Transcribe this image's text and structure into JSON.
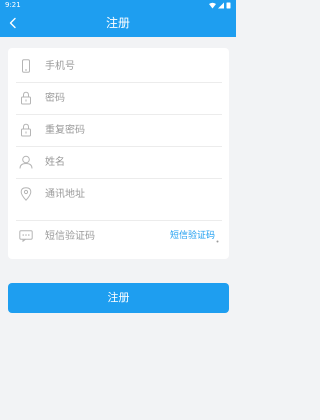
{
  "status_bar": {
    "time": "9:21"
  },
  "nav": {
    "title": "注册"
  },
  "form": {
    "phone_placeholder": "手机号",
    "password_placeholder": "密码",
    "confirm_password_placeholder": "重复密码",
    "name_placeholder": "姓名",
    "address_placeholder": "通讯地址",
    "sms_code_placeholder": "短信验证码",
    "sms_code_button": "短信验证码"
  },
  "actions": {
    "register_label": "注册"
  },
  "colors": {
    "accent": "#1e9ef0",
    "background": "#f2f3f5",
    "placeholder": "#9a9a9a"
  },
  "icons": [
    "back-arrow-icon",
    "wifi-icon",
    "signal-icon",
    "battery-icon",
    "phone-icon",
    "lock-icon",
    "user-icon",
    "location-pin-icon",
    "message-icon"
  ]
}
